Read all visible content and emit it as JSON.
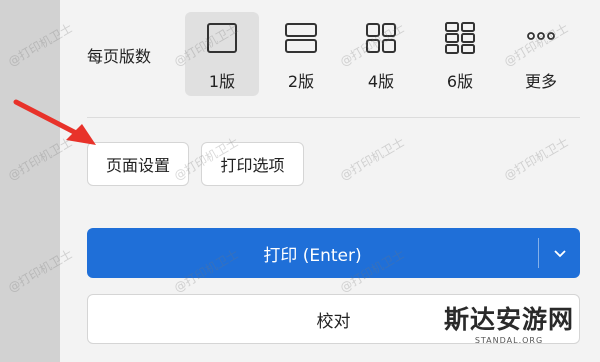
{
  "pages_per_sheet": {
    "label": "每页版数",
    "options": [
      {
        "label": "1版",
        "icon": "single-page-icon",
        "selected": true
      },
      {
        "label": "2版",
        "icon": "two-pages-icon",
        "selected": false
      },
      {
        "label": "4版",
        "icon": "four-pages-icon",
        "selected": false
      },
      {
        "label": "6版",
        "icon": "six-pages-icon",
        "selected": false
      },
      {
        "label": "更多",
        "icon": "more-dots-icon",
        "selected": false
      }
    ]
  },
  "buttons": {
    "page_setup": "页面设置",
    "print_options": "打印选项",
    "print": "打印 (Enter)",
    "proofread": "校对"
  },
  "watermark_text": "@打印机卫士",
  "brand": {
    "name": "斯达安游网",
    "domain": "STANDAL.ORG"
  },
  "colors": {
    "primary": "#1f6fd8",
    "arrow": "#e8322a",
    "selected_bg": "#e0e0e0"
  }
}
